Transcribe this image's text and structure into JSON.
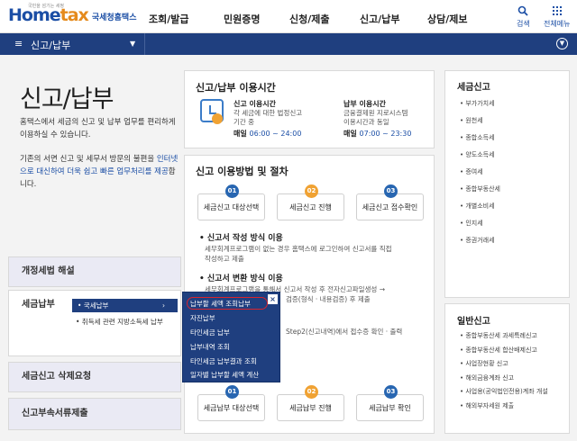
{
  "header": {
    "logo_tag": "국민을 섬기는 세정",
    "logo_main_a": "Home",
    "logo_main_b": "tax",
    "logo_sub": "국세청홈택스",
    "nav": [
      "조회/발급",
      "민원증명",
      "신청/제출",
      "신고/납부",
      "상담/제보"
    ],
    "search_label": "검색",
    "allmenu_label": "전체메뉴"
  },
  "bar": {
    "menu_icon": "≡",
    "title": "신고/납부",
    "caret": "▼",
    "right_icon": "▼"
  },
  "intro": {
    "page_title": "신고/납부",
    "desc1": "홈택스에서 세금의 신고 및 납부 업무를 편리하게 이용하실 수 있습니다.",
    "desc2_a": "기존의 서면 신고 및 세무서 방문의 불편을 ",
    "desc2_link": "인터넷으로 대신하여 더욱 쉽고 빠른 업무처리를 제공",
    "desc2_b": "합니다."
  },
  "left_menu": {
    "item1": "개정세법 해설",
    "item2": "세금납부",
    "item3": "세금신고 삭제요청",
    "item4": "신고부속서류제출",
    "sub_active": "• 국세납부",
    "sub_arrow": "›",
    "sub_other": "• 취득세 관련 지방소득세 납부"
  },
  "dropdown": {
    "close": "×",
    "items": [
      "납부할 세액 조회납부",
      "자진납부",
      "타인세금 납부",
      "납부내역 조회",
      "타인세금 납부결과 조회",
      "일자별 납부할 세액 계산"
    ]
  },
  "hours": {
    "title": "신고/납부 이용시간",
    "report_head": "신고 이용시간",
    "report_desc1": "각 세금에 대한 법정신고",
    "report_desc2": "기간 중",
    "report_time_label": "매일",
    "report_time": "06:00 ~ 24:00",
    "pay_head": "납부 이용시간",
    "pay_desc1": "금융결제원 지로시스템",
    "pay_desc2": "이용시간과 동일",
    "pay_time_label": "매일",
    "pay_time": "07:00 ~ 23:30"
  },
  "procedure": {
    "title": "신고 이용방법 및 절차",
    "steps_top": [
      {
        "num": "01",
        "label": "세금신고 대상선택"
      },
      {
        "num": "02",
        "label": "세금신고 진행"
      },
      {
        "num": "03",
        "label": "세금신고 접수확인"
      }
    ],
    "method1_title": "• 신고서 작성 방식 이용",
    "method1_desc1": "세무회계프로그램이 없는 경우 홈택스에 로그인하여 신고서를 직접",
    "method1_desc2": "작성하고 제출",
    "method2_title": "• 신고서 변환 방식 이용",
    "method2_desc1": "세무회계프로그램을 통해서 신고서 작성 후 전자신고파일생성 →",
    "method2_desc2": "검증(형식 · 내용검증) 후 제출",
    "method3_desc": "Step2(신고내역)에서 접수증 확인 · 출력",
    "steps_bottom": [
      {
        "num": "01",
        "label": "세금납부 대상선택"
      },
      {
        "num": "02",
        "label": "세금납부 진행"
      },
      {
        "num": "03",
        "label": "세금납부 확인"
      }
    ]
  },
  "tax_report": {
    "title": "세금신고",
    "items": [
      "부가가치세",
      "원천세",
      "종합소득세",
      "양도소득세",
      "증여세",
      "종합부동산세",
      "개별소비세",
      "인지세",
      "증권거래세"
    ]
  },
  "general_report": {
    "title": "일반신고",
    "items": [
      "종합부동산세 과세특례신고",
      "종합부동산세 합산배제신고",
      "사업장현황 신고",
      "해외금융계좌 신고",
      "사업용(공익법인전용)계좌 개설",
      "해외부자세원 제출"
    ]
  },
  "colors": {
    "brand_blue": "#1b4ea5",
    "bar_navy": "#1f3f7f",
    "accent_orange": "#f0a233",
    "highlight_red": "#d8242d"
  }
}
